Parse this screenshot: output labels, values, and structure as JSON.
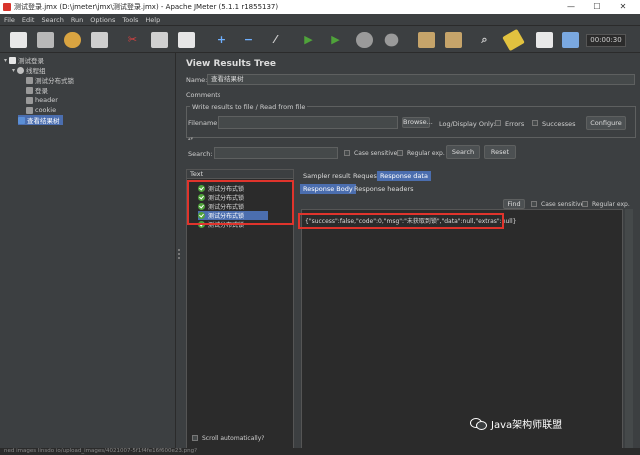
{
  "window": {
    "title": "测试登录.jmx (D:\\jmeter\\jmx\\测试登录.jmx) - Apache JMeter (5.1.1 r1855137)",
    "minimize": "—",
    "maximize": "☐",
    "close": "✕"
  },
  "menu": [
    "File",
    "Edit",
    "Search",
    "Run",
    "Options",
    "Tools",
    "Help"
  ],
  "toolbar": {
    "timer": "00:00:30",
    "colors": {
      "start": "#4fa33a",
      "stop": "#9a9a9a",
      "cut": "#e04141",
      "add": "#6fb0ff",
      "remove": "#6fb0ff"
    }
  },
  "tree": {
    "items": [
      {
        "label": "测试登录",
        "level": 0,
        "icon": "test-plan-icon",
        "color": "#e6e6e6"
      },
      {
        "label": "线程组",
        "level": 1,
        "icon": "thread-group-icon",
        "color": "#c0c0c0"
      },
      {
        "label": "测试分布式锁",
        "level": 2,
        "icon": "sampler-icon",
        "color": "#9a9a9a"
      },
      {
        "label": "登录",
        "level": 2,
        "icon": "sampler-icon",
        "color": "#9a9a9a"
      },
      {
        "label": "header",
        "level": 2,
        "icon": "config-icon",
        "color": "#9a9a9a"
      },
      {
        "label": "cookie",
        "level": 2,
        "icon": "config-icon",
        "color": "#9a9a9a"
      },
      {
        "label": "查看结果树",
        "level": 1,
        "icon": "listener-icon",
        "color": "#5b8fd6",
        "selected": true
      }
    ]
  },
  "main": {
    "title": "View Results Tree",
    "name_label": "Name:",
    "name_value": "查看结果树",
    "comments_label": "Comments:",
    "group_title": "Write results to file / Read from file",
    "filename_label": "Filename",
    "browse_label": "Browse...",
    "log_display_label": "Log/Display Only:",
    "errors_label": "Errors",
    "successes_label": "Successes",
    "configure_label": "Configure",
    "search_label": "Search:",
    "case_sensitive_label": "Case sensitive",
    "regular_exp_label": "Regular exp.",
    "search_button": "Search",
    "reset_button": "Reset",
    "scroll_auto_label": "Scroll automatically?"
  },
  "results": {
    "header": "Text",
    "rows": [
      "测试分布式锁",
      "测试分布式锁",
      "测试分布式锁",
      "测试分布式锁",
      "测试分布式锁"
    ],
    "selected_index": 3
  },
  "detail": {
    "tabs": [
      "Sampler result",
      "Request",
      "Response data"
    ],
    "active_tab": 2,
    "subtabs": [
      "Response Body",
      "Response headers"
    ],
    "active_subtab": 0,
    "find_button": "Find",
    "case_sensitive_label": "Case sensitive",
    "regular_exp_label": "Regular exp.",
    "response_text": "{\"success\":false,\"code\":0,\"msg\":\"未获取到锁\",\"data\":null,\"extras\":null}"
  },
  "watermark": "Java架构师联盟",
  "bottom_strip": "ned images linsdo io/upload_images/4021007-5f1f4fe16f600e23.png?"
}
